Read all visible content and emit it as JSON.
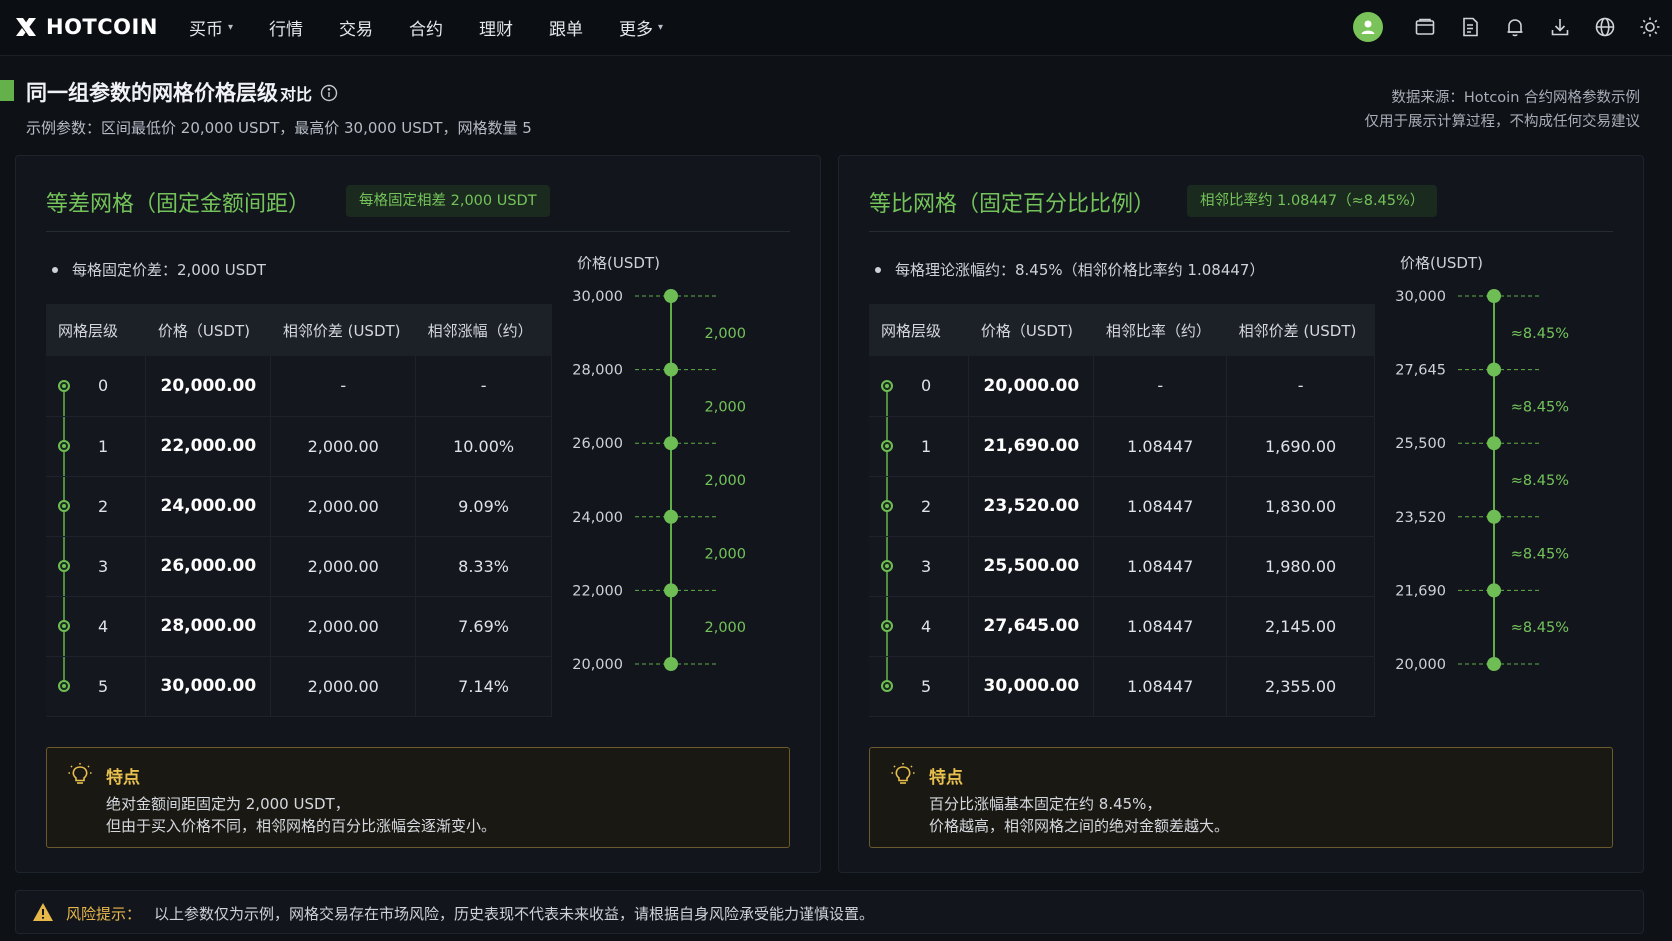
{
  "nav": {
    "logo_text": "HOTCOIN",
    "menu": [
      {
        "label": "买币",
        "caret": true
      },
      {
        "label": "行情",
        "caret": false
      },
      {
        "label": "交易",
        "caret": false
      },
      {
        "label": "合约",
        "caret": false
      },
      {
        "label": "理财",
        "caret": false
      },
      {
        "label": "跟单",
        "caret": false
      },
      {
        "label": "更多",
        "caret": true
      }
    ],
    "right_icons": [
      "avatar-icon",
      "wallet-icon",
      "orders-icon",
      "bell-icon",
      "download-icon",
      "globe-icon",
      "sun-icon"
    ]
  },
  "header": {
    "title": "同一组参数的网格价格层级",
    "title_suffix": "对比",
    "subtitle": "示例参数：区间最低价 20,000 USDT，最高价 30,000 USDT，网格数量 5",
    "source_line1": "数据来源：Hotcoin 合约网格参数示例",
    "source_line2": "仅用于展示计算过程，不构成任何交易建议"
  },
  "left": {
    "title": "等差网格（固定金额间距）",
    "badge": "每格固定相差 2,000 USDT",
    "bullet": "每格固定价差：2,000 USDT",
    "columns": [
      "网格层级",
      "价格（USDT)",
      "相邻价差 (USDT)",
      "相邻涨幅（约）"
    ],
    "rows": [
      [
        "0",
        "20,000.00",
        "-",
        "-"
      ],
      [
        "1",
        "22,000.00",
        "2,000.00",
        "10.00%"
      ],
      [
        "2",
        "24,000.00",
        "2,000.00",
        "9.09%"
      ],
      [
        "3",
        "26,000.00",
        "2,000.00",
        "8.33%"
      ],
      [
        "4",
        "28,000.00",
        "2,000.00",
        "7.69%"
      ],
      [
        "5",
        "30,000.00",
        "2,000.00",
        "7.14%"
      ]
    ],
    "ladder": {
      "axis_label": "价格(USDT)",
      "ticks": [
        "30,000",
        "28,000",
        "26,000",
        "24,000",
        "22,000",
        "20,000"
      ],
      "gaps": [
        "2,000",
        "2,000",
        "2,000",
        "2,000",
        "2,000"
      ]
    },
    "feature": {
      "title": "特点",
      "line1": "绝对金额间距固定为 2,000 USDT，",
      "line2": "但由于买入价格不同，相邻网格的百分比涨幅会逐渐变小。"
    }
  },
  "right": {
    "title": "等比网格（固定百分比比例）",
    "badge": "相邻比率约 1.08447（≈8.45%）",
    "bullet": "每格理论涨幅约：8.45%（相邻价格比率约 1.08447）",
    "columns": [
      "网格层级",
      "价格（USDT)",
      "相邻比率（约）",
      "相邻价差 (USDT)"
    ],
    "rows": [
      [
        "0",
        "20,000.00",
        "-",
        "-"
      ],
      [
        "1",
        "21,690.00",
        "1.08447",
        "1,690.00"
      ],
      [
        "2",
        "23,520.00",
        "1.08447",
        "1,830.00"
      ],
      [
        "3",
        "25,500.00",
        "1.08447",
        "1,980.00"
      ],
      [
        "4",
        "27,645.00",
        "1.08447",
        "2,145.00"
      ],
      [
        "5",
        "30,000.00",
        "1.08447",
        "2,355.00"
      ]
    ],
    "ladder": {
      "axis_label": "价格(USDT)",
      "ticks": [
        "30,000",
        "27,645",
        "25,500",
        "23,520",
        "21,690",
        "20,000"
      ],
      "gaps": [
        "≈8.45%",
        "≈8.45%",
        "≈8.45%",
        "≈8.45%",
        "≈8.45%"
      ]
    },
    "feature": {
      "title": "特点",
      "line1": "百分比涨幅基本固定在约 8.45%，",
      "line2": "价格越高，相邻网格之间的绝对金额差越大。"
    }
  },
  "risk": {
    "label": "风险提示：",
    "text": "以上参数仅为示例，网格交易存在市场风险，历史表现不代表未来收益，请根据自身风险承受能力谨慎设置。"
  },
  "colors": {
    "accent_green": "#74c35a",
    "badge_bg": "#1b2a1e",
    "warning_gold": "#e8c04e",
    "background": "#0e1116"
  }
}
